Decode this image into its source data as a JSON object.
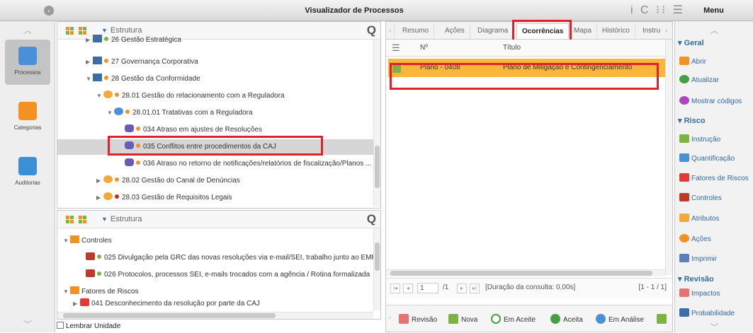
{
  "window": {
    "title": "Visualizador de Processos",
    "menu_label": "Menu",
    "top_icons": "i C ⁝⁝ ☰"
  },
  "nav": {
    "items": [
      {
        "label": "Processos",
        "icon": "gear-process-icon",
        "active": true
      },
      {
        "label": "Categorias",
        "icon": "folder-icon",
        "active": false
      },
      {
        "label": "Auditorias",
        "icon": "checklist-icon",
        "active": false
      }
    ]
  },
  "tree": {
    "filter": "Estrutura",
    "rows": [
      {
        "text": "26 Gestão Estratégica"
      },
      {
        "text": "27 Governança Corporativa"
      },
      {
        "text": "28 Gestão da Conformidade"
      },
      {
        "text": "28.01 Gestão do relacionamento com a Reguladora"
      },
      {
        "text": "28.01.01 Tratativas com a Reguladora"
      },
      {
        "text": "034 Atraso em ajustes de Resoluções"
      },
      {
        "text": "035 Conflitos entre procedimentos da CAJ"
      },
      {
        "text": "036 Atraso no retorno de notificações/relatórios de fiscalização/Planos ..."
      },
      {
        "text": "28.02 Gestão do Canal de Denúncias"
      },
      {
        "text": "28.03 Gestão de Requisitos Legais"
      }
    ]
  },
  "bottom_tree": {
    "filter": "Estrutura",
    "rows": [
      {
        "text": "Controles"
      },
      {
        "text": "025 Divulgação pela GRC das novas resoluções via e-mail/SEI, trabalho junto ao EMP r"
      },
      {
        "text": "026 Protocolos, processos SEI, e-mails trocados com a agência / Rotina formalizada"
      },
      {
        "text": "Fatores de Riscos"
      },
      {
        "text": "041 Desconhecimento da resolução por parte da CAJ"
      }
    ]
  },
  "remember_unit": "Lembrar Unidade",
  "tabs": [
    "Resumo",
    "Ações",
    "Diagrama",
    "Ocorrências",
    "Mapa",
    "Histórico",
    "Instru"
  ],
  "active_tab": "Ocorrências",
  "grid": {
    "columns": [
      "Nº",
      "Título"
    ],
    "rows": [
      {
        "number": "Plano - 0408",
        "title": "Plano de Mitigação e Contingenciamento"
      }
    ]
  },
  "pager": {
    "page": "1",
    "of": "/1",
    "duration": "[Duração da consulta: 0,00s]",
    "range": "[1 - 1 / 1]"
  },
  "actions": [
    "Revisão",
    "Nova",
    "Em Aceite",
    "Aceita",
    "Em Análise"
  ],
  "right_menu": {
    "sections": [
      {
        "title": "Geral",
        "items": [
          "Abrir",
          "Atualizar",
          "Mostrar códigos"
        ]
      },
      {
        "title": "Risco",
        "items": [
          "Instrução",
          "Quantificação",
          "Fatores de Riscos",
          "Controles",
          "Atributos",
          "Ações",
          "Imprimir"
        ]
      },
      {
        "title": "Revisão",
        "items": [
          "Impactos",
          "Probabilidade"
        ]
      }
    ]
  },
  "colors": {
    "highlight_row": "#f9b63b",
    "callout": "#e0202a",
    "link": "#3268a8"
  }
}
